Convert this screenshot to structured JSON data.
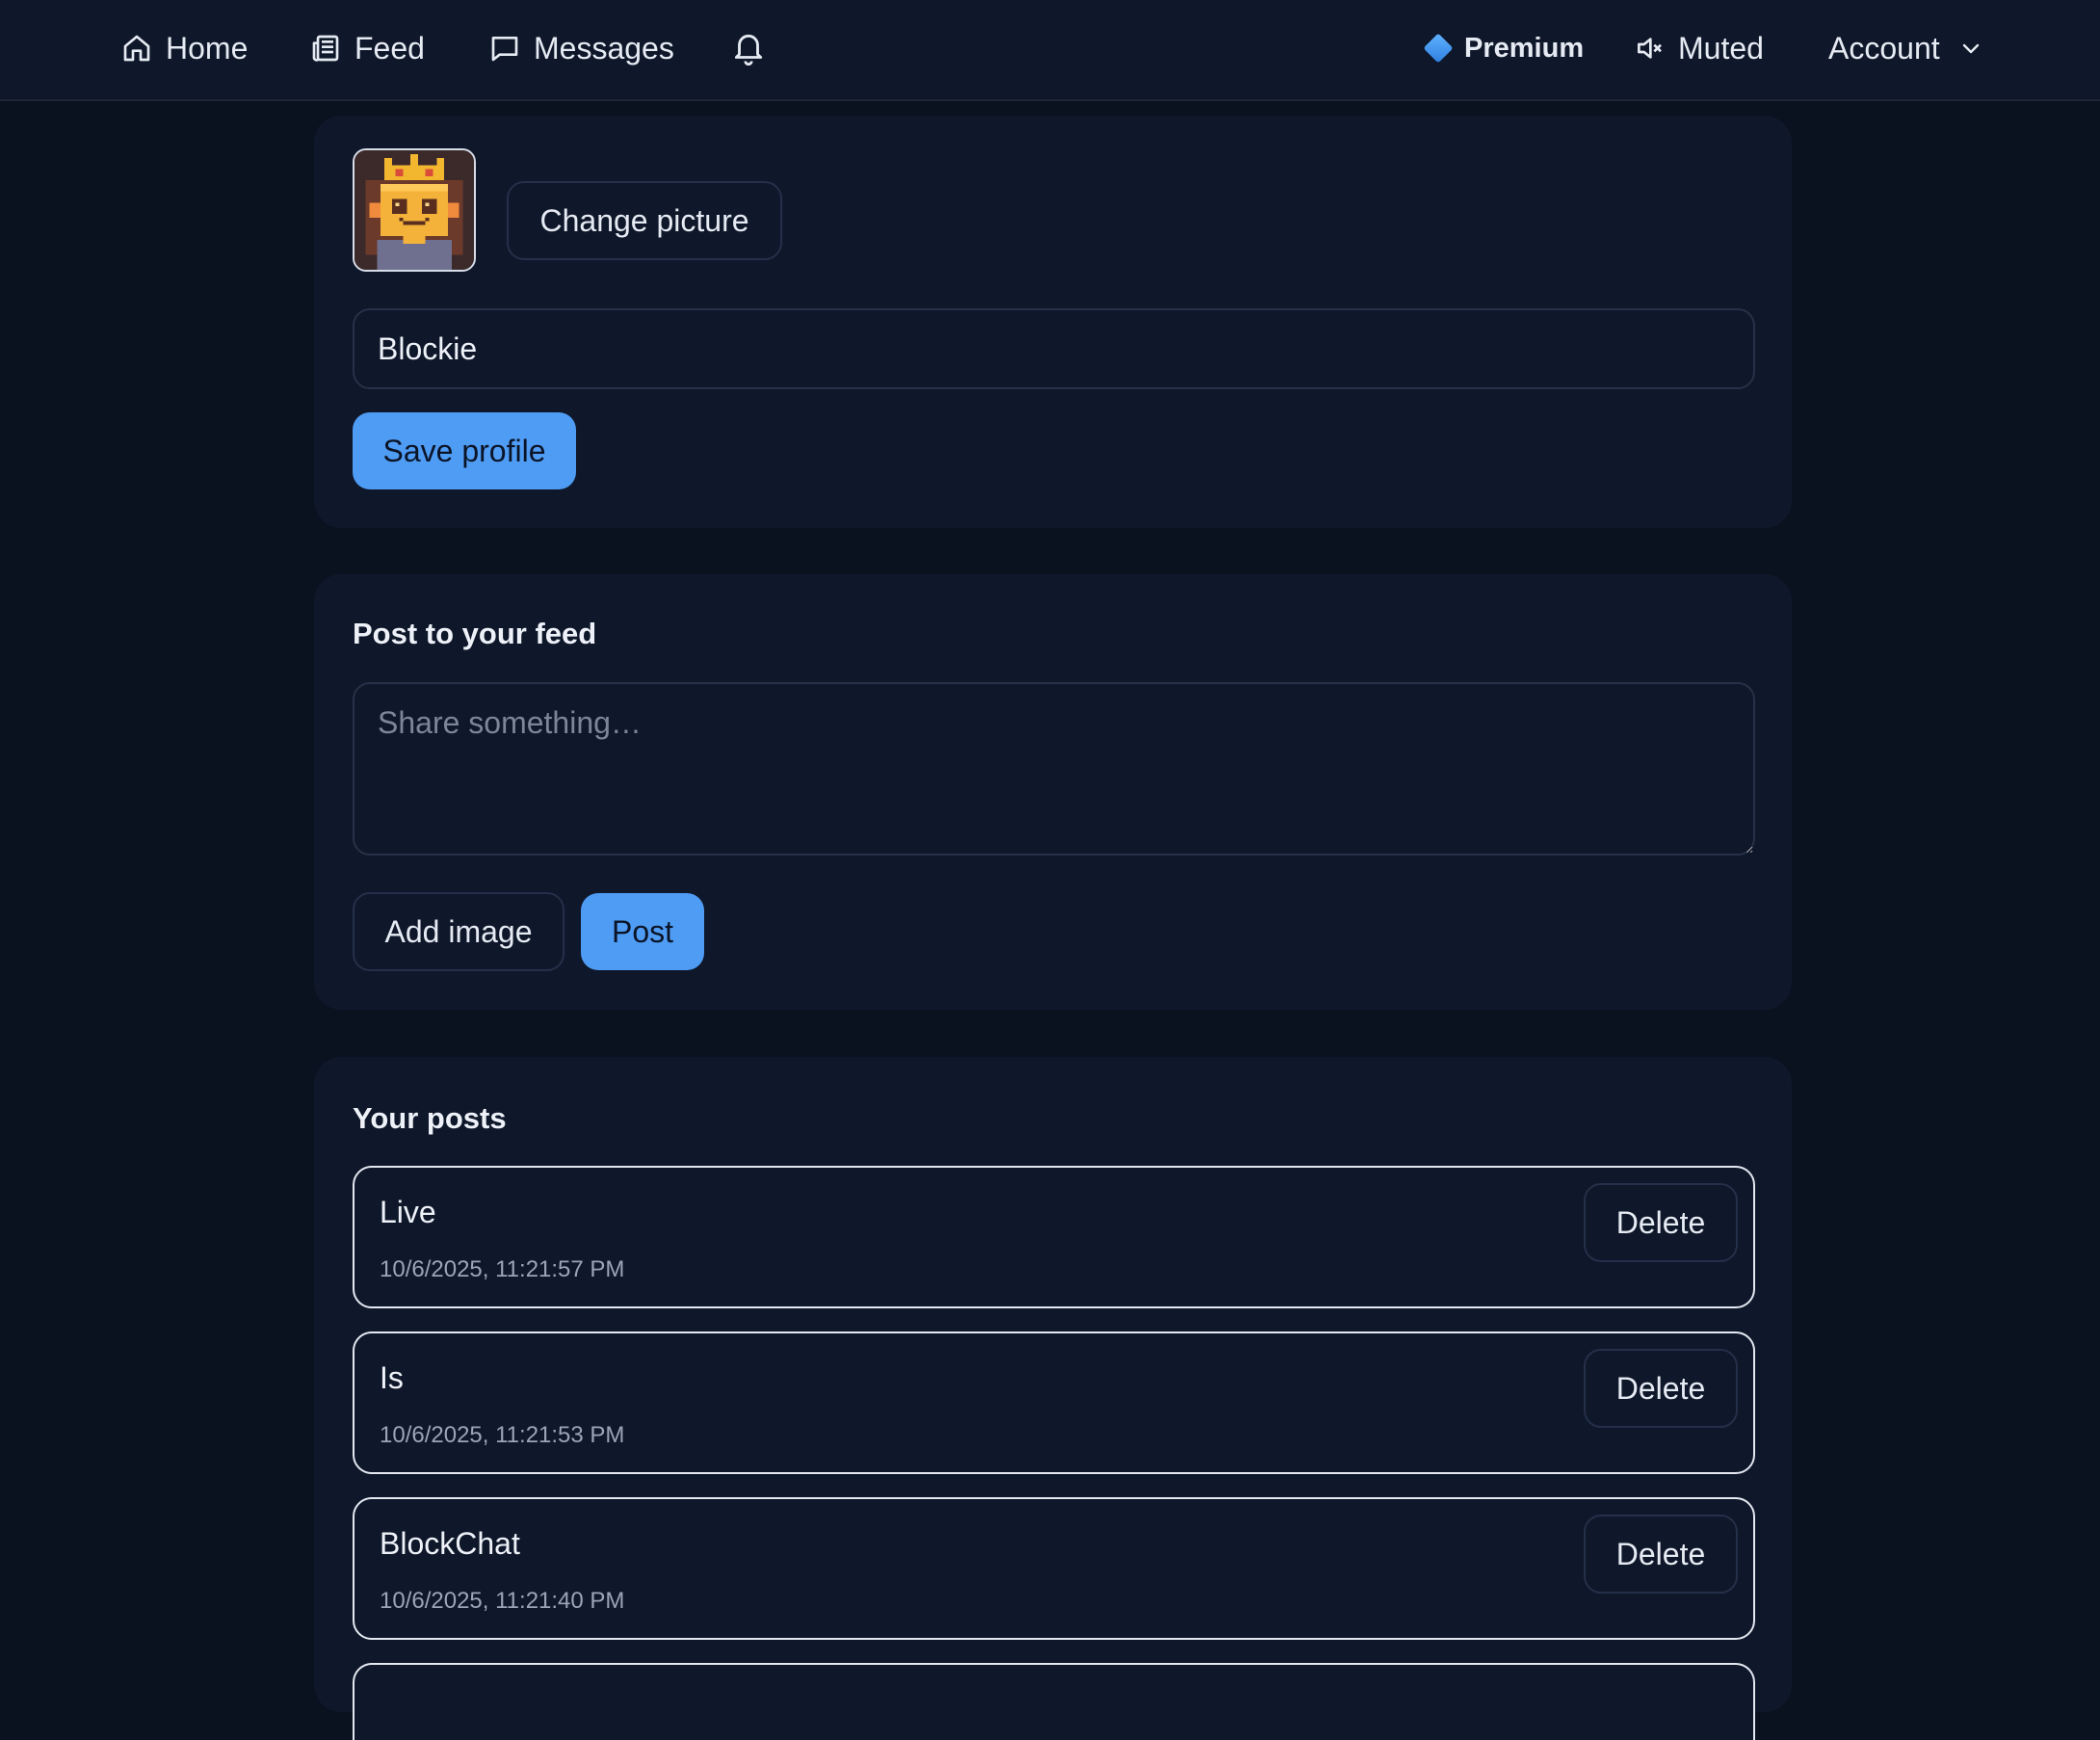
{
  "nav": {
    "home": "Home",
    "feed": "Feed",
    "messages": "Messages",
    "premium": "Premium",
    "muted": "Muted",
    "account": "Account"
  },
  "profile": {
    "change_picture": "Change picture",
    "name_value": "Blockie",
    "save": "Save profile"
  },
  "composer": {
    "title": "Post to your feed",
    "placeholder": "Share something…",
    "add_image": "Add image",
    "post": "Post"
  },
  "posts": {
    "title": "Your posts",
    "delete_label": "Delete",
    "items": [
      {
        "text": "Live",
        "time": "10/6/2025, 11:21:57 PM"
      },
      {
        "text": "Is",
        "time": "10/6/2025, 11:21:53 PM"
      },
      {
        "text": "BlockChat",
        "time": "10/6/2025, 11:21:40 PM"
      }
    ]
  },
  "colors": {
    "background": "#0a1220",
    "card": "#0f172a",
    "accent": "#4f9cf5",
    "border": "#263149"
  },
  "icons": [
    "home-icon",
    "newspaper-icon",
    "message-icon",
    "bell-icon",
    "diamond-icon",
    "speaker-muted-icon",
    "chevron-down-icon"
  ]
}
